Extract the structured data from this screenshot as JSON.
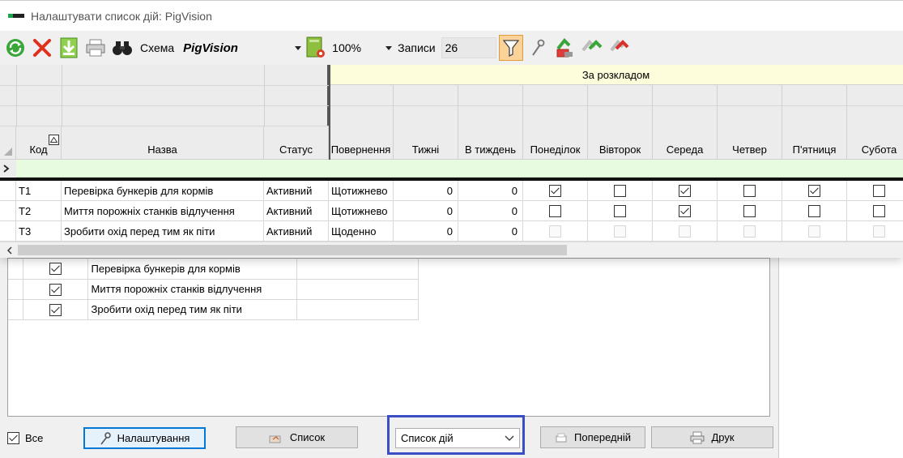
{
  "window": {
    "title": "Налаштувати список дій: PigVision"
  },
  "toolbar": {
    "schema_label": "Схема",
    "schema_value": "PigVision",
    "zoom_value": "100%",
    "records_label": "Записи",
    "records_value": "26"
  },
  "grid": {
    "group_header": "За розкладом",
    "columns": {
      "code": "Код",
      "name": "Назва",
      "status": "Статус",
      "recurrence": "Повернення",
      "weeks": "Тижні",
      "per_week": "В тиждень",
      "mon": "Понеділок",
      "tue": "Вівторок",
      "wed": "Середа",
      "thu": "Четвер",
      "fri": "П'ятниця",
      "sat": "Субота"
    },
    "rows": [
      {
        "code": "T1",
        "name": "Перевірка бункерів для кормів",
        "status": "Активний",
        "recurrence": "Щотижнево",
        "weeks": "0",
        "per_week": "0",
        "days": [
          true,
          false,
          true,
          false,
          true,
          false
        ],
        "days_enabled": true
      },
      {
        "code": "T2",
        "name": "Миття порожніх станків відлучення",
        "status": "Активний",
        "recurrence": "Щотижнево",
        "weeks": "0",
        "per_week": "0",
        "days": [
          false,
          false,
          true,
          false,
          false,
          false
        ],
        "days_enabled": true
      },
      {
        "code": "T3",
        "name": "Зробити охід перед тим як піти",
        "status": "Активний",
        "recurrence": "Щоденно",
        "weeks": "0",
        "per_week": "0",
        "days": [
          false,
          false,
          false,
          false,
          false,
          false
        ],
        "days_enabled": false
      }
    ]
  },
  "list": {
    "items": [
      {
        "checked": true,
        "name": "Перевірка бункерів для кормів"
      },
      {
        "checked": true,
        "name": "Миття порожніх станків відлучення"
      },
      {
        "checked": true,
        "name": "Зробити охід перед тим як піти"
      }
    ]
  },
  "footer": {
    "all_label": "Все",
    "all_checked": true,
    "settings_button": "Налаштування",
    "list_button": "Список",
    "view_select": "Список дій",
    "prev_button": "Попередній",
    "print_button": "Друк"
  },
  "colors": {
    "accent_focus": "#0078d7",
    "group_header_bg": "#fdfddc",
    "new_row_bg": "#e6fbe0",
    "highlight_frame": "#3b4fc4",
    "active_tool_bg": "#fbd29a"
  }
}
